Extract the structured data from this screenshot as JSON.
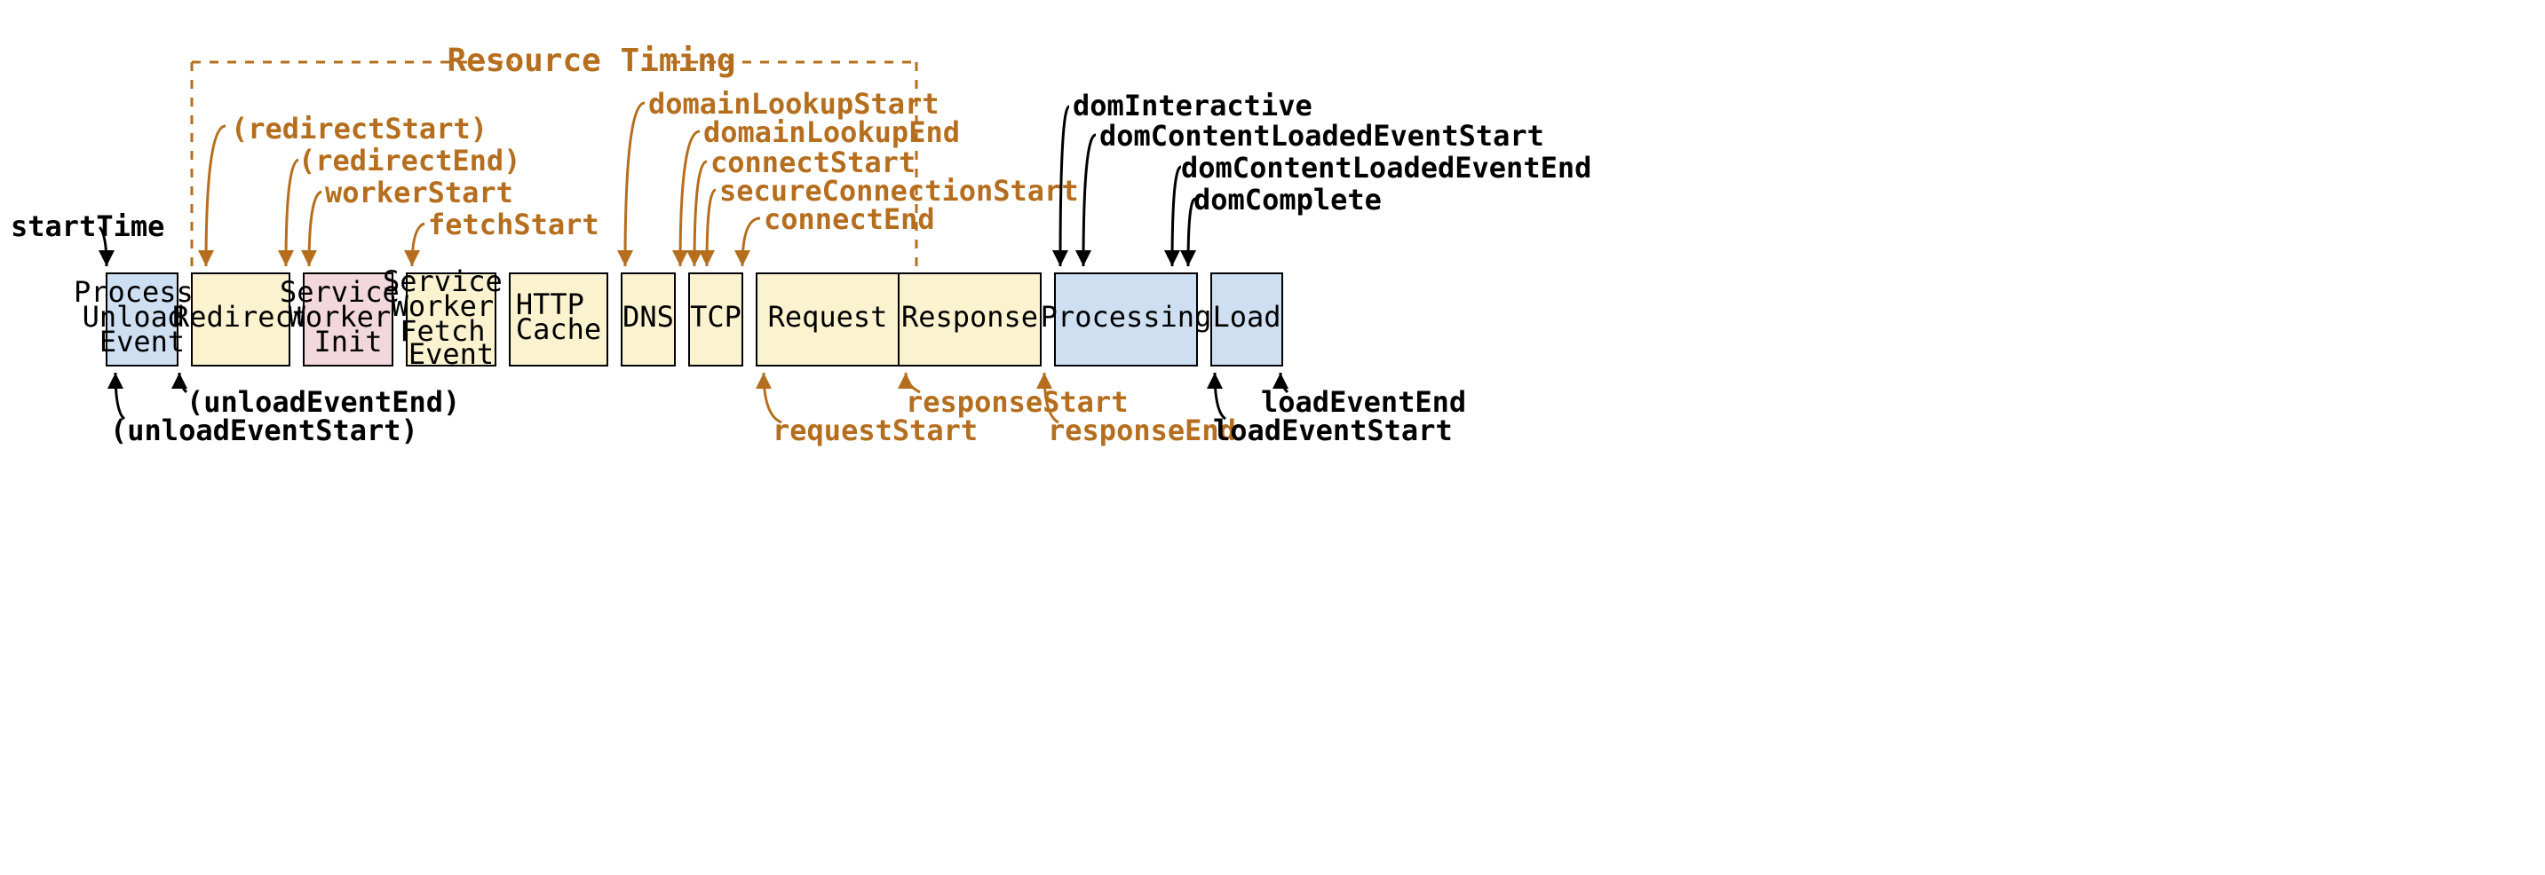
{
  "diagram": {
    "title": "Resource Timing",
    "boxes": {
      "processUnload": "Process\nUnload\nEvent",
      "redirect": "Redirect",
      "swInit": "Service\nWorker\nInit",
      "swFetch": "Service\nWorker\nFetch\nEvent",
      "httpCache": "HTTP\nCache",
      "dns": "DNS",
      "tcp": "TCP",
      "request": "Request",
      "response": "Response",
      "processing": "Processing",
      "load": "Load"
    },
    "labels": {
      "startTime": "startTime",
      "unloadEventStart": "(unloadEventStart)",
      "unloadEventEnd": "(unloadEventEnd)",
      "redirectStart": "(redirectStart)",
      "redirectEnd": "(redirectEnd)",
      "workerStart": "workerStart",
      "fetchStart": "fetchStart",
      "domainLookupStart": "domainLookupStart",
      "domainLookupEnd": "domainLookupEnd",
      "connectStart": "connectStart",
      "secureConnectionStart": "secureConnectionStart",
      "connectEnd": "connectEnd",
      "requestStart": "requestStart",
      "responseStart": "responseStart",
      "responseEnd": "responseEnd",
      "domInteractive": "domInteractive",
      "domContentLoadedEventStart": "domContentLoadedEventStart",
      "domContentLoadedEventEnd": "domContentLoadedEventEnd",
      "domComplete": "domComplete",
      "loadEventStart": "loadEventStart",
      "loadEventEnd": "loadEventEnd"
    }
  }
}
